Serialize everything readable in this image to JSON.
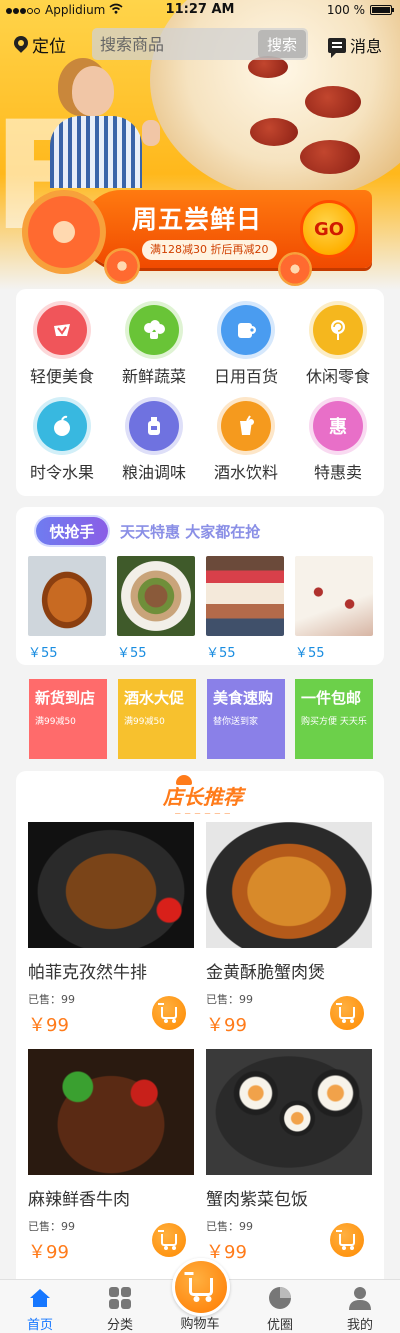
{
  "status_bar": {
    "carrier": "Applidium",
    "time": "11:27 AM",
    "battery": "100 %"
  },
  "header": {
    "location_label": "定位",
    "search_placeholder": "搜索商品",
    "search_button": "搜索",
    "message_label": "消息"
  },
  "promo": {
    "title": "周五尝鲜日",
    "subtitle": "满128减30 折后再减20",
    "go_label": "GO"
  },
  "categories": [
    {
      "label": "轻便美食",
      "icon": "food-icon",
      "color": "#f0555a"
    },
    {
      "label": "新鲜蔬菜",
      "icon": "vegetable-icon",
      "color": "#69c437"
    },
    {
      "label": "日用百货",
      "icon": "tissue-icon",
      "color": "#4a9cf0"
    },
    {
      "label": "休闲零食",
      "icon": "lollipop-icon",
      "color": "#f5b71e"
    },
    {
      "label": "时令水果",
      "icon": "fruit-icon",
      "color": "#38b8e0"
    },
    {
      "label": "粮油调味",
      "icon": "oil-icon",
      "color": "#6f72e0"
    },
    {
      "label": "酒水饮料",
      "icon": "drink-icon",
      "color": "#f59a1e"
    },
    {
      "label": "特惠卖",
      "icon": "discount-icon",
      "color": "#e86fc8",
      "glyph": "惠"
    }
  ],
  "flash_sale": {
    "tag": "快抢手",
    "slogan": "天天特惠  大家都在抢",
    "items": [
      {
        "price": "￥55",
        "icon": "roast-chicken-image"
      },
      {
        "price": "￥55",
        "icon": "salad-image"
      },
      {
        "price": "￥55",
        "icon": "parfait-image"
      },
      {
        "price": "￥55",
        "icon": "nougat-image"
      }
    ]
  },
  "promo_tiles": [
    {
      "title": "新货到店",
      "sub": "满99减50",
      "color": "#ff6b6b"
    },
    {
      "title": "酒水大促",
      "sub": "满99减50",
      "color": "#f7c12e"
    },
    {
      "title": "美食速购",
      "sub": "替你送到家",
      "color": "#8a80e8"
    },
    {
      "title": "一件包邮",
      "sub": "购买方便  天天乐",
      "color": "#6cd04a"
    }
  ],
  "recommend": {
    "title": "店长推荐",
    "products": [
      {
        "name": "帕菲克孜然牛排",
        "sold": "已售：99",
        "price": "￥99"
      },
      {
        "name": "金黄酥脆蟹肉煲",
        "sold": "已售：99",
        "price": "￥99"
      },
      {
        "name": "麻辣鲜香牛肉",
        "sold": "已售：99",
        "price": "￥99"
      },
      {
        "name": "蟹肉紫菜包饭",
        "sold": "已售：99",
        "price": "￥99"
      }
    ]
  },
  "tabbar": {
    "home": "首页",
    "category": "分类",
    "cart": "购物车",
    "discover": "优圈",
    "mine": "我的"
  },
  "colors": {
    "accent": "#ff7b1a",
    "active_tab": "#1677ff"
  }
}
